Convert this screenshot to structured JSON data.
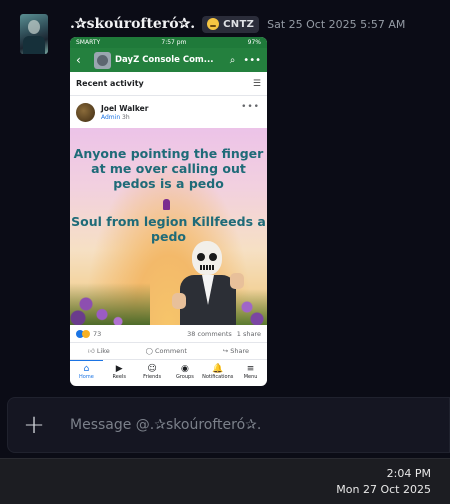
{
  "message": {
    "username": ".✰skoúrofteró✰.",
    "tag": {
      "emoji": "face-with-tongue",
      "text": "CNTZ"
    },
    "timestamp": "Sat 25 Oct 2025 5:57 AM"
  },
  "screenshot": {
    "status_bar": {
      "carrier": "SMARTY",
      "time": "7:57 pm",
      "battery": "97%"
    },
    "group_name": "DayZ Console Com...",
    "section_title": "Recent activity",
    "post": {
      "author": "Joel Walker",
      "role": "Admin",
      "time_ago": "3h",
      "meme_text_top": "Anyone pointing the finger at me over calling out pedos is a pedo",
      "meme_text_bottom": "Soul from legion Killfeeds a pedo",
      "reaction_count": "73",
      "comments": "38 comments",
      "shares": "1 share",
      "actions": [
        "Like",
        "Comment",
        "Share"
      ]
    },
    "tabs": [
      {
        "label": "Home",
        "icon": "⌂"
      },
      {
        "label": "Reels",
        "icon": "▶"
      },
      {
        "label": "Friends",
        "icon": "☺"
      },
      {
        "label": "Groups",
        "icon": "◉"
      },
      {
        "label": "Notifications",
        "icon": "🔔"
      },
      {
        "label": "Menu",
        "icon": "≡"
      }
    ]
  },
  "composer": {
    "placeholder": "Message @.✰skoúrofteró✰."
  },
  "taskbar": {
    "time": "2:04 PM",
    "date": "Mon 27 Oct 2025"
  },
  "colors": {
    "background": "#0b0c16",
    "fb_green": "#24803e",
    "fb_blue": "#1b74e4",
    "meme_text": "#1f6b78"
  }
}
